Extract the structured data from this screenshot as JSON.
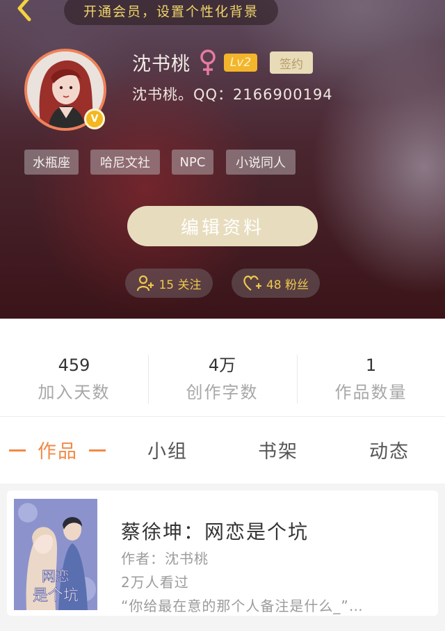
{
  "colors": {
    "accent": "#f08a46",
    "gold": "#efc94b",
    "level": "#f3b52b",
    "edit_button": "#e7dcbd"
  },
  "header": {
    "vip_banner": "开通会员，设置个性化背景"
  },
  "profile": {
    "username": "沈书桃",
    "gender_icon": "female-icon",
    "level": "Lv2",
    "signed": "签约",
    "subtitle": "沈书桃。QQ：2166900194",
    "vip_badge": "V"
  },
  "tags": [
    "水瓶座",
    "哈尼文社",
    "NPC",
    "小说同人"
  ],
  "edit_button": "编辑资料",
  "follow": {
    "icon": "add-user-icon",
    "label": "15 关注"
  },
  "fans": {
    "icon": "heart-plus-icon",
    "label": "48 粉丝"
  },
  "stats": [
    {
      "value": "459",
      "label": "加入天数"
    },
    {
      "value": "4万",
      "label": "创作字数"
    },
    {
      "value": "1",
      "label": "作品数量"
    }
  ],
  "tabs": [
    "作品",
    "小组",
    "书架",
    "动态"
  ],
  "active_tab": "作品",
  "works": [
    {
      "title": "蔡徐坤：网恋是个坑",
      "author": "作者：沈书桃",
      "views": "2万人看过",
      "excerpt": "“你给最在意的那个人备注是什么_”…",
      "cover_text": "网恋是个坑"
    }
  ]
}
